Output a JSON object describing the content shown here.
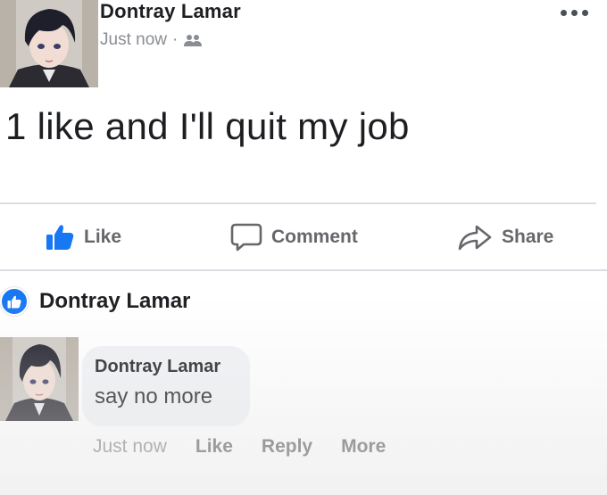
{
  "post": {
    "author": "Dontray Lamar",
    "time": "Just now",
    "separator": "·",
    "audience_icon": "friends-icon",
    "more_icon": "more-options-icon",
    "text": "1 like and I'll quit my job"
  },
  "actions": {
    "like": "Like",
    "comment": "Comment",
    "share": "Share"
  },
  "reaction": {
    "icon": "like-reaction-icon",
    "name": "Dontray Lamar"
  },
  "comment": {
    "author": "Dontray Lamar",
    "text": "say no more",
    "time": "Just now",
    "like": "Like",
    "reply": "Reply",
    "more": "More"
  },
  "colors": {
    "brand_blue": "#1877f2",
    "action_gray": "#65676b",
    "bubble_bg": "#f0f2f5"
  }
}
